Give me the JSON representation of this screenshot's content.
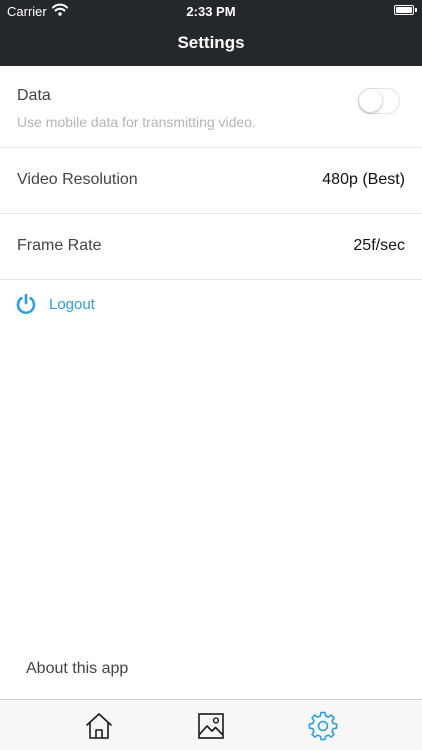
{
  "status_bar": {
    "carrier": "Carrier",
    "time": "2:33 PM",
    "battery_level": 1.0
  },
  "nav": {
    "title": "Settings"
  },
  "settings": {
    "data": {
      "label": "Data",
      "description": "Use mobile data for transmitting video.",
      "enabled": false
    },
    "video_resolution": {
      "label": "Video Resolution",
      "value": "480p (Best)"
    },
    "frame_rate": {
      "label": "Frame Rate",
      "value": "25f/sec"
    }
  },
  "logout": {
    "label": "Logout",
    "icon": "power-icon"
  },
  "about": {
    "label": "About this app"
  },
  "tabbar": {
    "tabs": [
      {
        "icon": "home-icon",
        "active": false
      },
      {
        "icon": "image-icon",
        "active": false
      },
      {
        "icon": "gear-icon",
        "active": true
      }
    ]
  },
  "colors": {
    "header": "#24282c",
    "accent": "#2b9fdb",
    "tab_inactive": "#1a1a1a"
  }
}
